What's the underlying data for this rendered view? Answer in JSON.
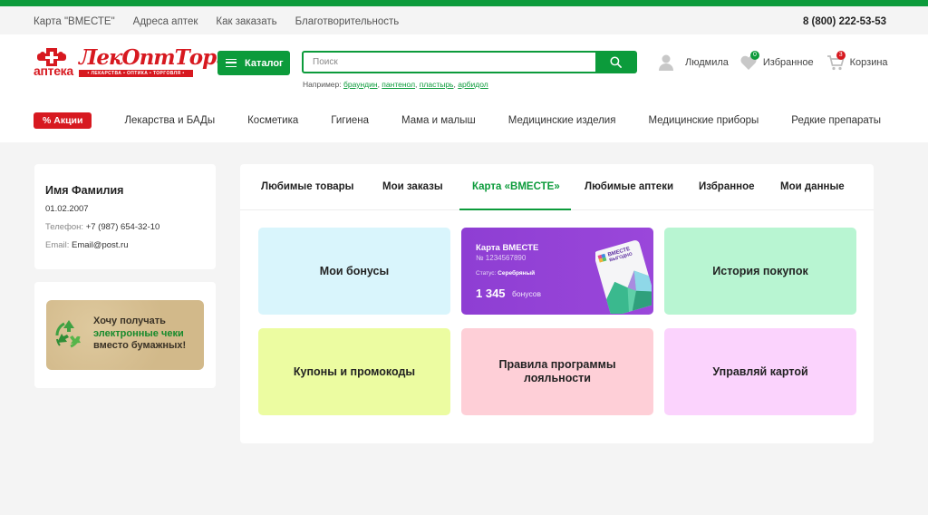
{
  "utility": {
    "links": [
      "Карта \"ВМЕСТЕ\"",
      "Адреса аптек",
      "Как заказать",
      "Благотворительность"
    ],
    "phone": "8 (800) 222-53-53"
  },
  "logo": {
    "apteka": "аптека",
    "brand": "ЛекОптТорг",
    "tagline": "• ЛЕКАРСТВА • ОПТИКА • ТОРГОВЛЯ •"
  },
  "header": {
    "catalog_label": "Каталог",
    "search_placeholder": "Поиск",
    "examples_label": "Например:",
    "examples": [
      "браундин",
      "пантенол",
      "пластырь",
      "арбидол"
    ],
    "user_name": "Людмила",
    "favorites_label": "Избранное",
    "favorites_count": "0",
    "cart_label": "Корзина",
    "cart_count": "3"
  },
  "nav": {
    "sale_label": "% Акции",
    "items": [
      "Лекарства и БАДы",
      "Косметика",
      "Гигиена",
      "Мама и малыш",
      "Медицинские изделия",
      "Медицинские приборы",
      "Редкие препараты"
    ]
  },
  "profile": {
    "name": "Имя Фамилия",
    "birthdate": "01.02.2007",
    "phone_label": "Телефон:",
    "phone": "+7 (987) 654-32-10",
    "email_label": "Email:",
    "email": "Email@post.ru"
  },
  "promo": {
    "line1": "Хочу получать",
    "line2": "электронные чеки",
    "line3": "вместо бумажных!"
  },
  "tabs": [
    "Любимые товары",
    "Мои заказы",
    "Карта «ВМЕСТЕ»",
    "Любимые аптеки",
    "Избранное",
    "Мои данные"
  ],
  "active_tab": "Карта «ВМЕСТЕ»",
  "tiles": {
    "bonuses": "Мои бонусы",
    "history": "История покупок",
    "coupons": "Купоны и промокоды",
    "rules_line1": "Правила программы",
    "rules_line2": "лояльности",
    "manage": "Управляй картой"
  },
  "card": {
    "title": "Карта ВМЕСТЕ",
    "number": "№ 1234567890",
    "status_label": "Статус:",
    "status": "Серебряный",
    "points": "1 345",
    "points_unit": "бонусов",
    "mini_card_text1": "ВМЕСТЕ",
    "mini_card_text2": "ВЫГОДНО"
  },
  "colors": {
    "brand_green": "#0c9b3b",
    "brand_red": "#d71920",
    "card_purple": "#8e3ed3",
    "tile_blue": "#d9f5fc",
    "tile_green": "#b8f5d2",
    "tile_yellow": "#ecfca1",
    "tile_pink": "#fecfd7",
    "tile_lilac": "#fbd3fd"
  }
}
